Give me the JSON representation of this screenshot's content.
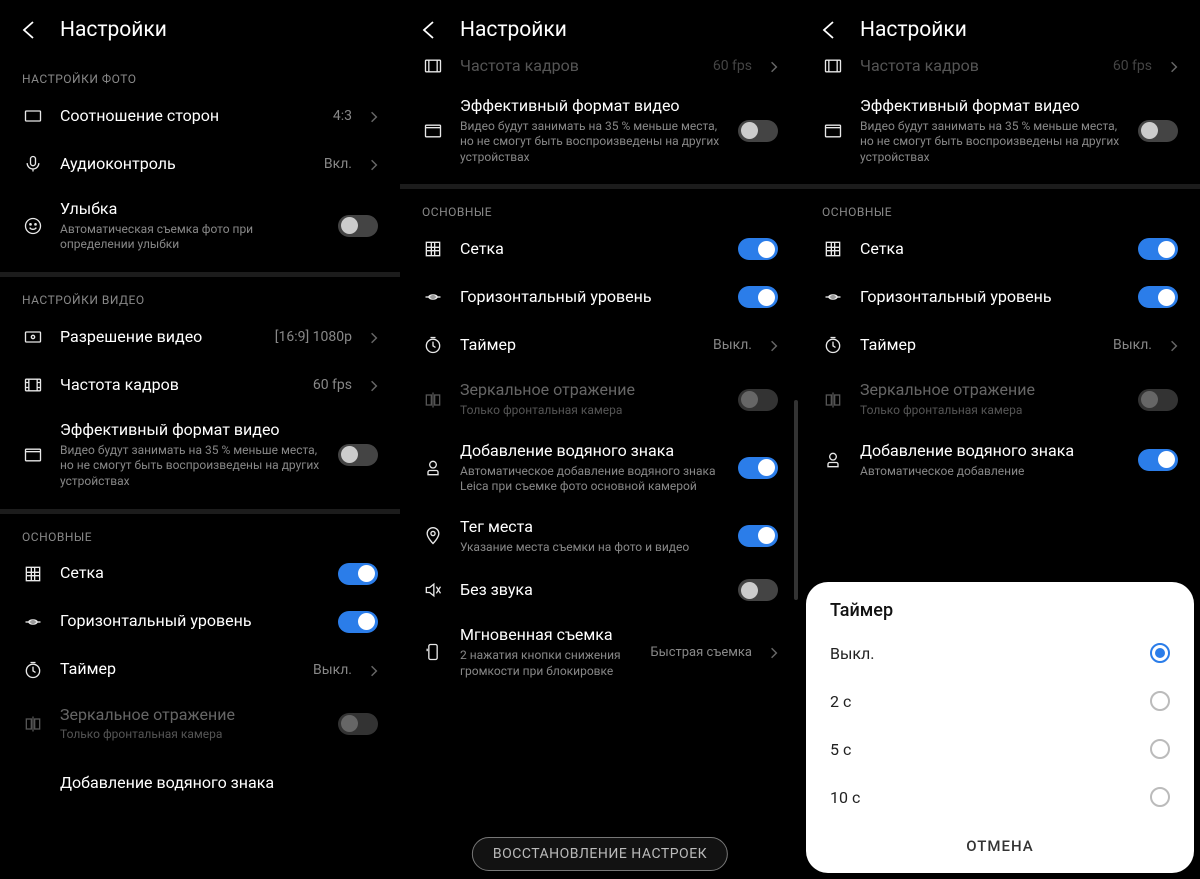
{
  "header": {
    "title": "Настройки"
  },
  "sections": {
    "photo_label": "НАСТРОЙКИ ФОТО",
    "video_label": "НАСТРОЙКИ ВИДЕО",
    "general_label": "ОСНОВНЫЕ"
  },
  "rows": {
    "aspect": {
      "title": "Соотношение сторон",
      "value": "4:3"
    },
    "audio": {
      "title": "Аудиоконтроль",
      "value": "Вкл."
    },
    "smile": {
      "title": "Улыбка",
      "sub": "Автоматическая съемка фото при определении улыбки"
    },
    "resolution": {
      "title": "Разрешение видео",
      "value": "[16:9] 1080p"
    },
    "fps": {
      "title": "Частота кадров",
      "value": "60 fps"
    },
    "effformat": {
      "title": "Эффективный формат видео",
      "sub": "Видео будут занимать на 35 % меньше места, но не смогут быть воспроизведены на других устройствах"
    },
    "grid": {
      "title": "Сетка"
    },
    "level": {
      "title": "Горизонтальный уровень"
    },
    "timer": {
      "title": "Таймер",
      "value": "Выкл."
    },
    "mirror": {
      "title": "Зеркальное отражение",
      "sub": "Только фронтальная камера"
    },
    "watermark": {
      "title": "Добавление водяного знака",
      "sub": "Автоматическое добавление водяного знака Leica при съемке фото основной камерой"
    },
    "watermark_short": {
      "sub": "Автоматическое добавление"
    },
    "geotag": {
      "title": "Тег места",
      "sub": "Указание места съемки на фото и видео"
    },
    "mute": {
      "title": "Без звука"
    },
    "instant": {
      "title": "Мгновенная съемка",
      "sub": "2 нажатия кнопки снижения громкости при блокировке",
      "value": "Быстрая съемка"
    }
  },
  "reset_label": "ВОССТАНОВЛЕНИЕ НАСТРОЕК",
  "timer_sheet": {
    "title": "Таймер",
    "options": [
      "Выкл.",
      "2 с",
      "5 с",
      "10 с"
    ],
    "cancel": "ОТМЕНА"
  }
}
